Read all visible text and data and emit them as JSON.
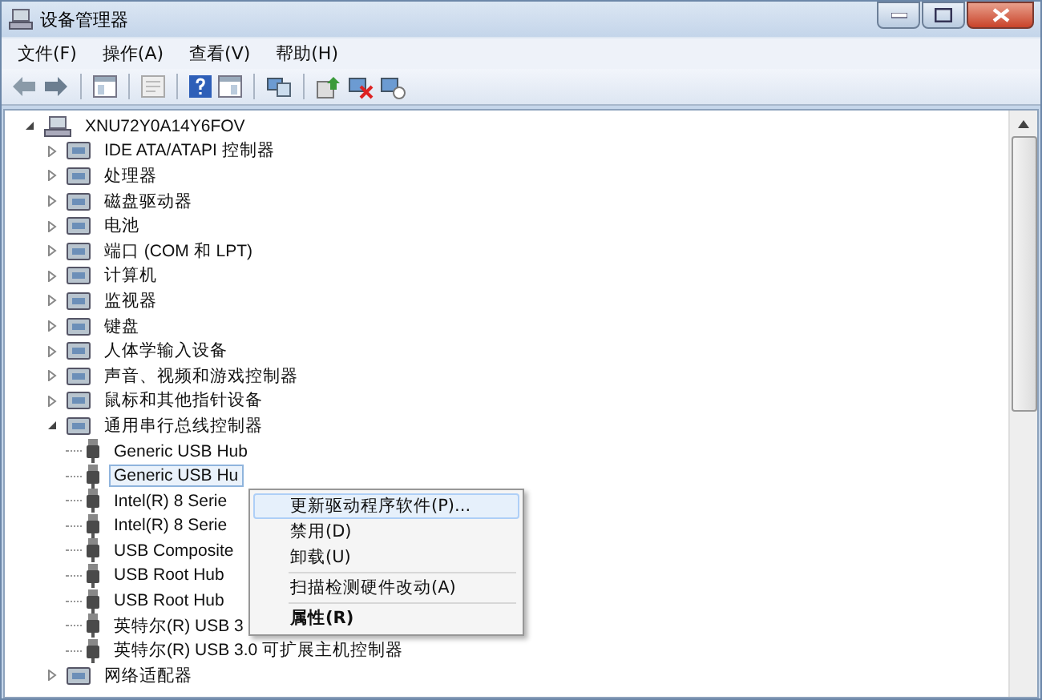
{
  "window": {
    "title": "设备管理器"
  },
  "menu_bar": [
    {
      "label": "文件(F)"
    },
    {
      "label": "操作(A)"
    },
    {
      "label": "查看(V)"
    },
    {
      "label": "帮助(H)"
    }
  ],
  "tree": {
    "label": "XNU72Y0A14Y6FOV",
    "expanded": true,
    "children": [
      {
        "label": "IDE ATA/ATAPI 控制器",
        "expanded": false
      },
      {
        "label": "处理器",
        "expanded": false
      },
      {
        "label": "磁盘驱动器",
        "expanded": false
      },
      {
        "label": "电池",
        "expanded": false
      },
      {
        "label": "端口 (COM 和 LPT)",
        "expanded": false
      },
      {
        "label": "计算机",
        "expanded": false
      },
      {
        "label": "监视器",
        "expanded": false
      },
      {
        "label": "键盘",
        "expanded": false
      },
      {
        "label": "人体学输入设备",
        "expanded": false
      },
      {
        "label": "声音、视频和游戏控制器",
        "expanded": false
      },
      {
        "label": "鼠标和其他指针设备",
        "expanded": false
      },
      {
        "label": "通用串行总线控制器",
        "expanded": true,
        "children": [
          {
            "label": "Generic USB Hub",
            "selected": false
          },
          {
            "label": "Generic USB Hu",
            "selected": true
          },
          {
            "label": "Intel(R) 8 Serie",
            "selected": false
          },
          {
            "label": "Intel(R) 8 Serie",
            "selected": false
          },
          {
            "label": "USB Composite",
            "selected": false
          },
          {
            "label": "USB Root Hub",
            "selected": false
          },
          {
            "label": "USB Root Hub",
            "selected": false
          },
          {
            "label": "英特尔(R) USB 3",
            "selected": false
          },
          {
            "label": "英特尔(R) USB 3.0 可扩展主机控制器",
            "selected": false
          }
        ]
      },
      {
        "label": "网络适配器",
        "expanded": false
      }
    ]
  },
  "context_menu": [
    {
      "kind": "item",
      "label": "更新驱动程序软件(P)...",
      "selected": true,
      "bold": false
    },
    {
      "kind": "item",
      "label": "禁用(D)",
      "selected": false,
      "bold": false
    },
    {
      "kind": "item",
      "label": "卸载(U)",
      "selected": false,
      "bold": false
    },
    {
      "kind": "separator"
    },
    {
      "kind": "item",
      "label": "扫描检测硬件改动(A)",
      "selected": false,
      "bold": false
    },
    {
      "kind": "separator"
    },
    {
      "kind": "item",
      "label": "属性(R)",
      "selected": false,
      "bold": true
    }
  ]
}
